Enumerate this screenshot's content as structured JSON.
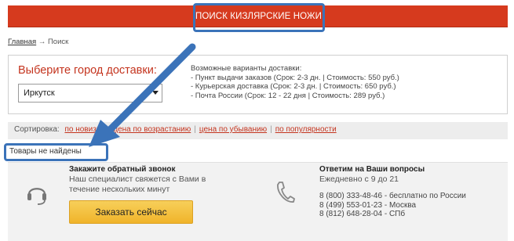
{
  "header": {
    "search_label": "ПОИСК КИЗЛЯРСКИЕ НОЖИ"
  },
  "breadcrumb": {
    "home": "Главная",
    "separator": "→",
    "current": "Поиск"
  },
  "delivery": {
    "title": "Выберите город доставки:",
    "selected_city": "Иркутск",
    "options_heading": "Возможные варианты доставки:",
    "options": [
      "- Пункт выдачи заказов (Срок: 2-3 дн. | Стоимость: 550 руб.)",
      "- Курьерская доставка (Срок: 2-3 дн. | Стоимость: 650 руб.)",
      "- Почта России (Срок: 12 - 22 дня | Стоимость: 289 руб.)"
    ]
  },
  "sort": {
    "label": "Сортировка:",
    "items": [
      "по новизне",
      "цена по возрастанию",
      "цена по убыванию",
      "по популярности"
    ]
  },
  "results": {
    "message": "Товары не найдены"
  },
  "callback": {
    "title": "Закажите обратный звонок",
    "description": "Наш специалист свяжется с Вами в течение нескольких минут",
    "button": "Заказать сейчас"
  },
  "contact": {
    "title": "Ответим на Ваши вопросы",
    "hours": "Ежедневно с 9 до 21",
    "phones": [
      "8 (800) 333-48-46 - бесплатно по России",
      "8 (499) 553-01-23 - Москва",
      "8 (812) 648-28-04 - СПб"
    ]
  },
  "colors": {
    "brand_red": "#d63a1e",
    "highlight_blue": "#3b73b9",
    "button_yellow": "#f0b42a"
  }
}
